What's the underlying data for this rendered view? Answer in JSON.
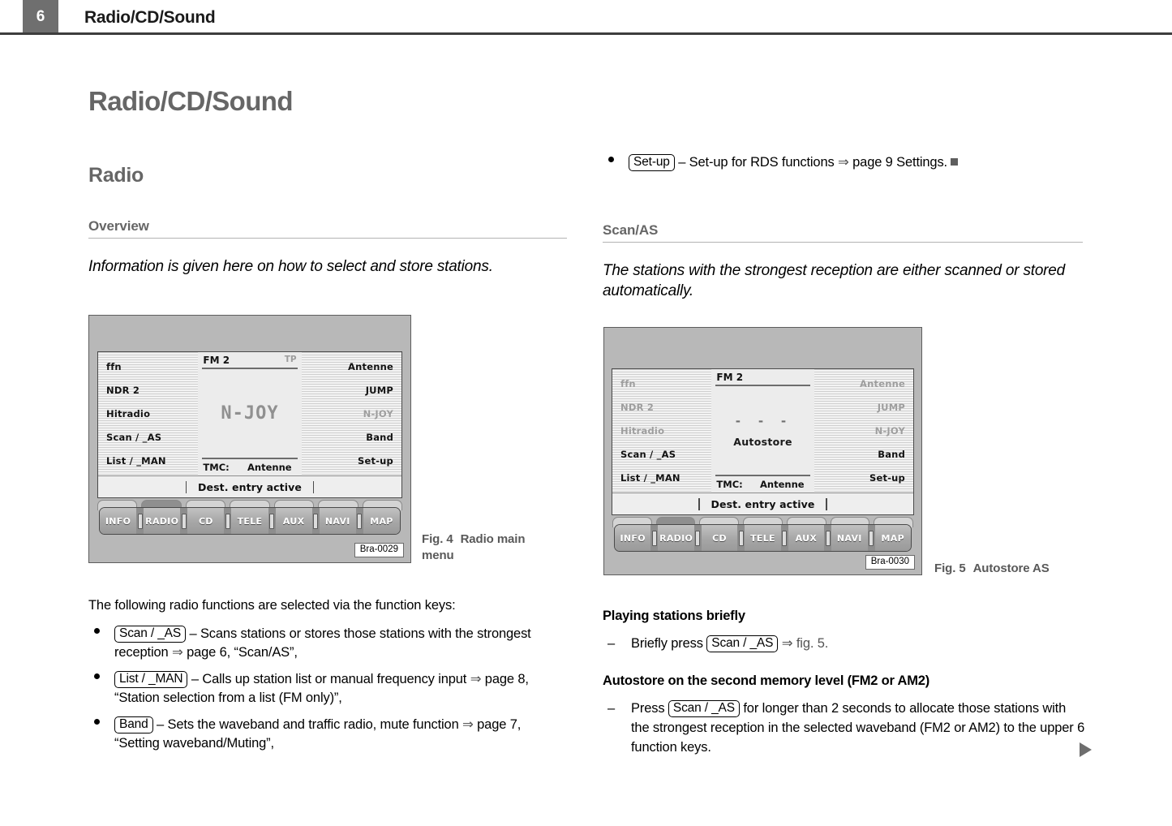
{
  "header": {
    "page_number": "6",
    "title": "Radio/CD/Sound"
  },
  "left_column": {
    "chapter_title": "Radio/CD/Sound",
    "section_title": "Radio",
    "sub_title": "Overview",
    "intro": "Information is given here on how to select and store stations.",
    "lead_text": "The following radio functions are selected via the function keys:",
    "bullets": [
      {
        "key": "Scan / _AS",
        "text_before": "– Scans stations or stores those stations with the strongest reception ",
        "arrow": "⇒",
        "text_after": " page 6, “Scan/AS”,"
      },
      {
        "key": "List / _MAN",
        "text_before": "– Calls up station list or manual frequency input ",
        "arrow": "⇒",
        "text_after": " page 8, “Station selection from a list (FM only)”,"
      },
      {
        "key": "Band",
        "text_before": "– Sets the waveband and traffic radio, mute function ",
        "arrow": "⇒",
        "text_after": " page 7, “Setting waveband/Muting”,"
      }
    ]
  },
  "right_column": {
    "top_bullet": {
      "key": "Set-up",
      "text_before": "– Set-up for RDS functions ",
      "arrow": "⇒",
      "text_after": " page 9 Settings."
    },
    "sub_title": "Scan/AS",
    "intro": "The stations with the strongest reception are either scanned or stored automatically.",
    "blocks": [
      {
        "heading": "Playing stations briefly",
        "dash": "–",
        "text_before": "Briefly press ",
        "key": "Scan / _AS",
        "arrow": "⇒",
        "text_after": " fig. 5."
      },
      {
        "heading": "Autostore on the second memory level (FM2 or AM2)",
        "dash": "–",
        "text_before": "Press ",
        "key": "Scan / _AS",
        "arrow": "",
        "text_after": " for longer than 2 seconds to allocate those stations with the strongest reception in the selected waveband (FM2 or AM2) to the upper 6 function keys."
      }
    ]
  },
  "figure4": {
    "caption_number": "Fig. 4",
    "caption_text": "Radio main menu",
    "code": "Bra-0029",
    "left_items": [
      {
        "label": "ffn",
        "dim": false
      },
      {
        "label": "NDR 2",
        "dim": false
      },
      {
        "label": "Hitradio",
        "dim": false
      },
      {
        "label": "Scan / _AS",
        "dim": false
      },
      {
        "label": "List / _MAN",
        "dim": false
      }
    ],
    "right_items": [
      {
        "label": "Antenne",
        "dim": false
      },
      {
        "label": "JUMP",
        "dim": false
      },
      {
        "label": "N-JOY",
        "dim": true
      },
      {
        "label": "Band",
        "dim": false
      },
      {
        "label": "Set-up",
        "dim": false
      }
    ],
    "center": {
      "band": "FM 2",
      "tp": "TP",
      "station": "N-JOY",
      "tmc_label": "TMC:",
      "tmc_value": "Antenne"
    },
    "status": "Dest. entry active",
    "buttons": [
      "INFO",
      "RADIO",
      "CD",
      "TELE",
      "AUX",
      "NAVI",
      "MAP"
    ]
  },
  "figure5": {
    "caption_number": "Fig. 5",
    "caption_text": "Autostore AS",
    "code": "Bra-0030",
    "left_items": [
      {
        "label": "ffn",
        "dim": true
      },
      {
        "label": "NDR 2",
        "dim": true
      },
      {
        "label": "Hitradio",
        "dim": true
      },
      {
        "label": "Scan / _AS",
        "dim": false
      },
      {
        "label": "List / _MAN",
        "dim": false
      }
    ],
    "right_items": [
      {
        "label": "Antenne",
        "dim": true
      },
      {
        "label": "JUMP",
        "dim": true
      },
      {
        "label": "N-JOY",
        "dim": true
      },
      {
        "label": "Band",
        "dim": false
      },
      {
        "label": "Set-up",
        "dim": false
      }
    ],
    "center": {
      "band": "FM 2",
      "tp": "",
      "dashes": "- - -",
      "autostore": "Autostore",
      "tmc_label": "TMC:",
      "tmc_value": "Antenne"
    },
    "status": "Dest. entry active",
    "buttons": [
      "INFO",
      "RADIO",
      "CD",
      "TELE",
      "AUX",
      "NAVI",
      "MAP"
    ]
  },
  "colors": {
    "heading_gray": "#666666",
    "header_tab": "#6f6f6f",
    "figure_frame": "#b8b8b8"
  }
}
